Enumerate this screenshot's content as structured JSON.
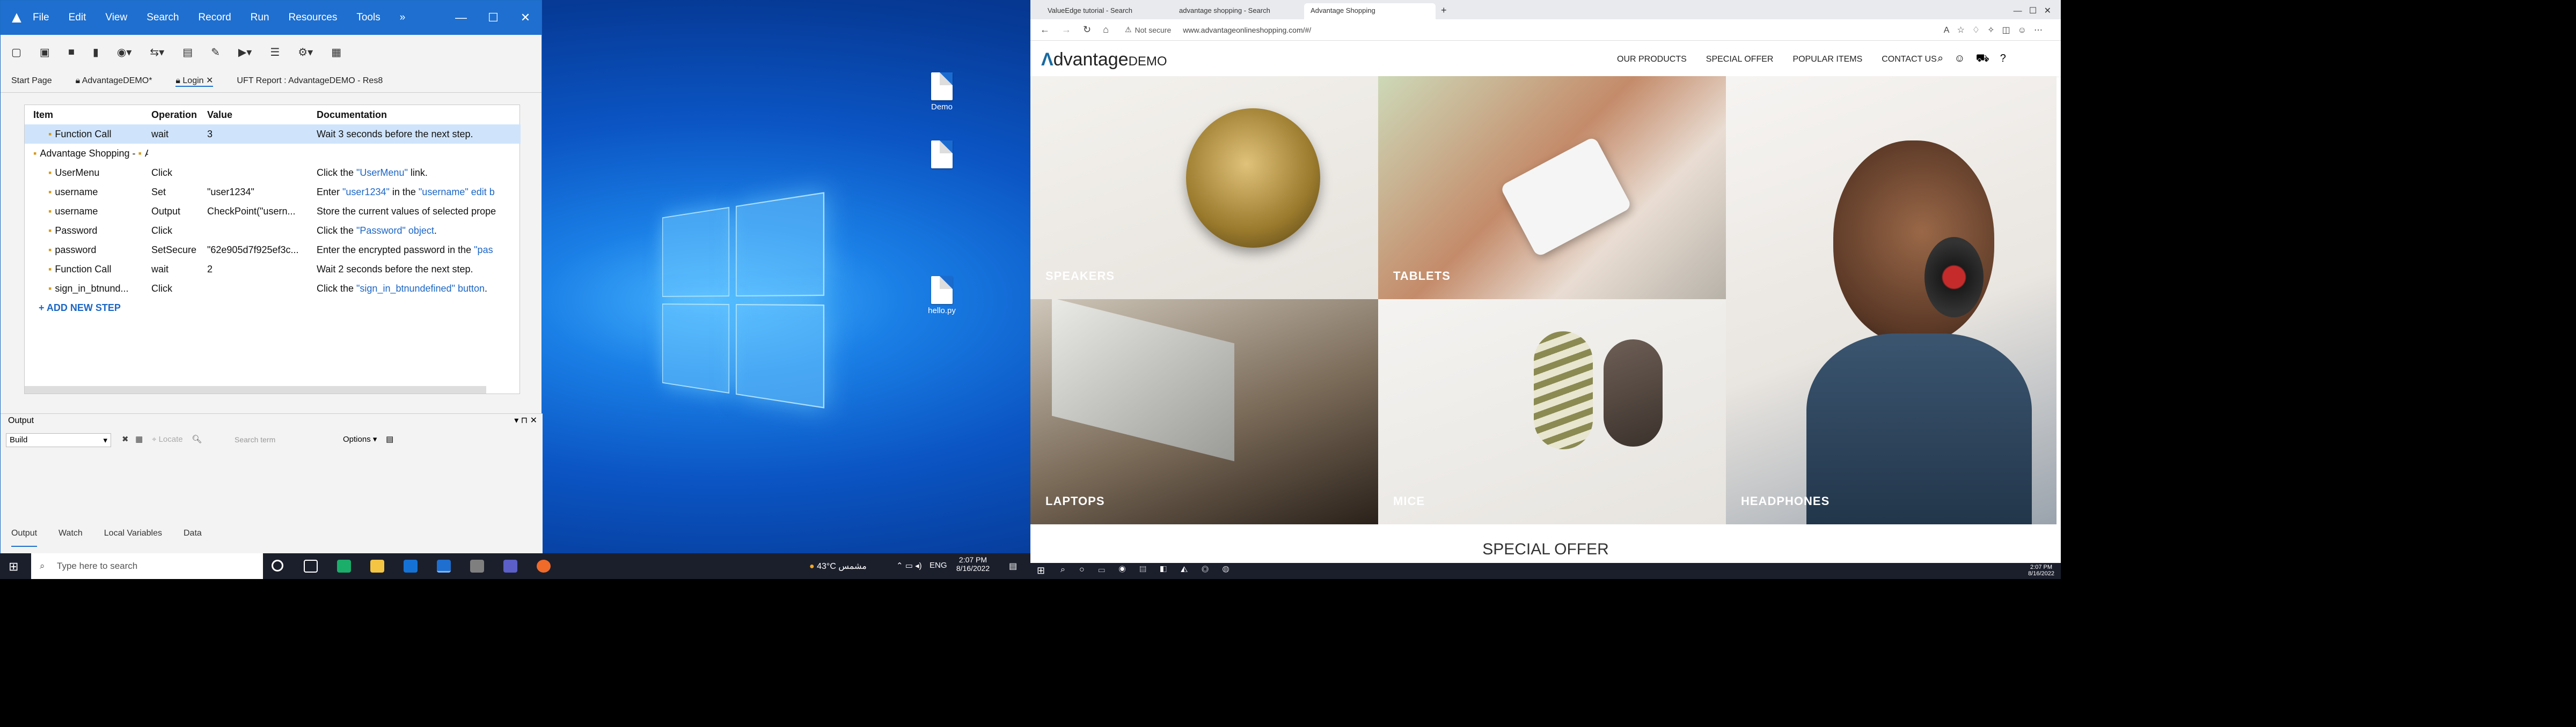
{
  "uft": {
    "menu": [
      "File",
      "Edit",
      "View",
      "Search",
      "Record",
      "Run",
      "Resources",
      "Tools",
      "»"
    ],
    "tabs": [
      "Start Page",
      "AdvantageDEMO*",
      "Login",
      "UFT Report : AdvantageDEMO - Res8"
    ],
    "headers": [
      "Item",
      "Operation",
      "Value",
      "Documentation"
    ],
    "rows": [
      {
        "item": "Function Call",
        "op": "wait",
        "val": "3",
        "doc": "Wait 3 seconds before the next step.",
        "sel": true
      },
      {
        "item": "Advantage Shopping - ",
        "item2": "Advantage Shopping",
        "op": "",
        "val": "",
        "doc": ""
      },
      {
        "item": "UserMenu",
        "op": "Click",
        "val": "",
        "doc": "Click the ",
        "link": "\"UserMenu\"",
        "doc2": " link."
      },
      {
        "item": "username",
        "op": "Set",
        "val": "\"user1234\"",
        "doc": "Enter ",
        "link": "\"user1234\"",
        "doc2": " in the ",
        "link2": "\"username\" edit b"
      },
      {
        "item": "username",
        "op": "Output",
        "val": "CheckPoint(\"usern...",
        "doc": "Store the current values of selected prope"
      },
      {
        "item": "Password",
        "op": "Click",
        "val": "",
        "doc": "Click the ",
        "link": "\"Password\" object",
        "doc2": "."
      },
      {
        "item": "password",
        "op": "SetSecure",
        "val": "\"62e905d7f925ef3c...",
        "doc": "Enter the encrypted password in the ",
        "link": "\"pas"
      },
      {
        "item": "Function Call",
        "op": "wait",
        "val": "2",
        "doc": "Wait 2 seconds before the next step."
      },
      {
        "item": "sign_in_btnund...",
        "op": "Click",
        "val": "",
        "doc": "Click the ",
        "link": "\"sign_in_btnundefined\" button",
        "doc2": "."
      }
    ],
    "add_step": "+ ADD NEW STEP",
    "output_title": "Output",
    "output_build": "Build",
    "output_search_placeholder": "Search term",
    "output_options": "Options",
    "bottom_tabs": [
      "Output",
      "Watch",
      "Local Variables",
      "Data"
    ]
  },
  "desktop1": {
    "icons": [
      "Demo",
      "",
      "hello.py"
    ],
    "taskbar": {
      "search": "Type here to search",
      "weather": "43°C مشمس",
      "lang": "ENG",
      "time": "2:07 PM",
      "date": "8/16/2022"
    }
  },
  "edge": {
    "tabs": [
      "ValueEdge tutorial - Search",
      "advantage shopping - Search",
      "Advantage Shopping"
    ],
    "address_warning": "Not secure",
    "url": "www.advantageonlineshopping.com/#/",
    "logo_main": "dvantage",
    "logo_sub": "DEMO",
    "nav": [
      "OUR PRODUCTS",
      "SPECIAL OFFER",
      "POPULAR ITEMS",
      "CONTACT US"
    ],
    "tiles": [
      "SPEAKERS",
      "TABLETS",
      "LAPTOPS",
      "MICE",
      "HEADPHONES"
    ],
    "special_offer": "SPECIAL OFFER",
    "taskbar": {
      "time": "2:07 PM",
      "date": "8/16/2022"
    }
  }
}
